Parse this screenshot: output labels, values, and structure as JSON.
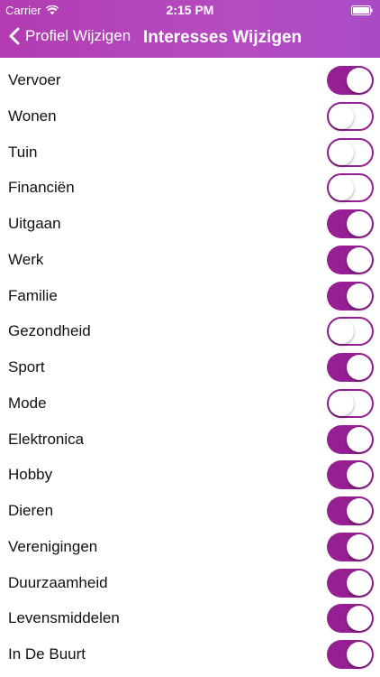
{
  "status_bar": {
    "carrier": "Carrier",
    "time": "2:15 PM"
  },
  "nav": {
    "back_label": "Profiel Wijzigen",
    "title": "Interesses Wijzigen"
  },
  "colors": {
    "header": "#b54bc0",
    "toggle_on": "#951f93"
  },
  "icons": {
    "back": "chevron-left-icon",
    "wifi": "wifi-icon",
    "battery": "battery-icon"
  },
  "interests": [
    {
      "label": "Vervoer",
      "enabled": true
    },
    {
      "label": "Wonen",
      "enabled": false
    },
    {
      "label": "Tuin",
      "enabled": false
    },
    {
      "label": "Financiën",
      "enabled": false
    },
    {
      "label": "Uitgaan",
      "enabled": true
    },
    {
      "label": "Werk",
      "enabled": true
    },
    {
      "label": "Familie",
      "enabled": true
    },
    {
      "label": "Gezondheid",
      "enabled": false
    },
    {
      "label": "Sport",
      "enabled": true
    },
    {
      "label": "Mode",
      "enabled": false
    },
    {
      "label": "Elektronica",
      "enabled": true
    },
    {
      "label": "Hobby",
      "enabled": true
    },
    {
      "label": "Dieren",
      "enabled": true
    },
    {
      "label": "Verenigingen",
      "enabled": true
    },
    {
      "label": "Duurzaamheid",
      "enabled": true
    },
    {
      "label": "Levensmiddelen",
      "enabled": true
    },
    {
      "label": "In De Buurt",
      "enabled": true
    }
  ]
}
